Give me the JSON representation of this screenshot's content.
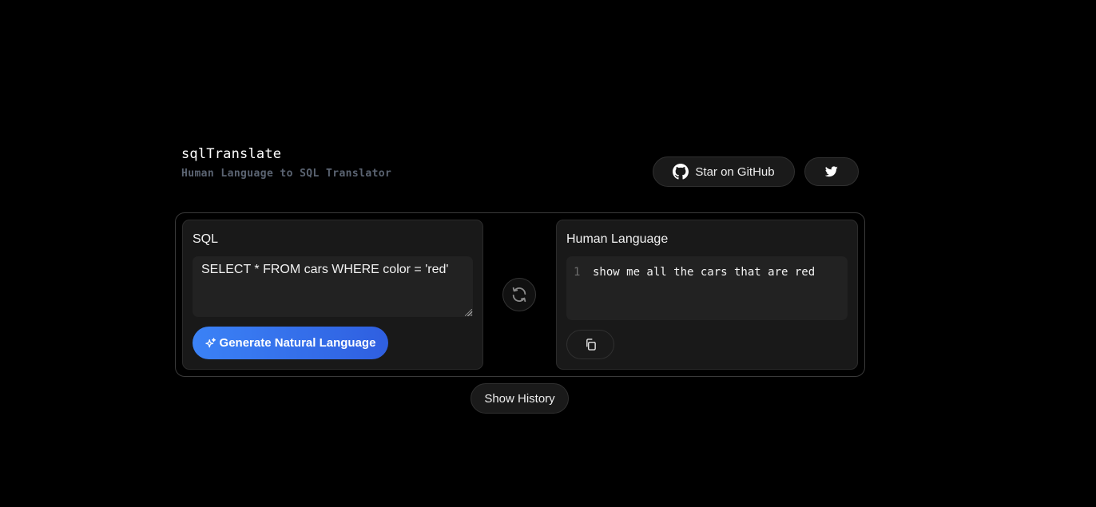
{
  "app": {
    "title": "sqlTranslate",
    "subtitle": "Human Language to SQL Translator"
  },
  "header": {
    "github_label": "Star on GitHub",
    "github_icon": "github-icon",
    "twitter_icon": "twitter-icon"
  },
  "sql_panel": {
    "title": "SQL",
    "input_value": "SELECT * FROM cars WHERE color = 'red'",
    "generate_label": "Generate Natural Language",
    "generate_icon": "sparkles-icon"
  },
  "swap": {
    "icon": "swap-arrows-icon"
  },
  "human_panel": {
    "title": "Human Language",
    "line_number": "1",
    "output_text": "show me all the cars that are red",
    "copy_icon": "copy-icon"
  },
  "footer": {
    "history_label": "Show History"
  },
  "colors": {
    "background": "#000000",
    "card": "#191919",
    "accent_start": "#3b82f6",
    "accent_end": "#2f5fe0",
    "subtitle": "#5b6472"
  }
}
